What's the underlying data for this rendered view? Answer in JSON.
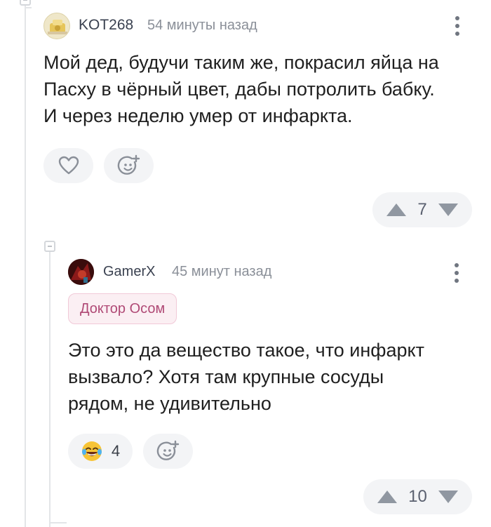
{
  "comments": [
    {
      "username": "KOT268",
      "time": "54 минуты назад",
      "lines": [
        "Мой дед, будучи таким же, покрасил яйца на",
        "Пасху в чёрный цвет, дабы потролить бабку.",
        "И через неделю умер от инфаркта."
      ],
      "rating": "7"
    },
    {
      "username": "GamerX",
      "time": "45 минут назад",
      "badge": "Доктор Осом",
      "lines": [
        "Это это да вещество такое, что инфаркт",
        "вызвало? Хотя там крупные сосуды",
        "рядом, не удивительно"
      ],
      "reaction_count": "4",
      "rating": "10"
    }
  ],
  "icons": {
    "like": "heart-icon",
    "add_reaction": "add-emoji-icon",
    "upvote": "triangle-up-icon",
    "downvote": "triangle-down-icon",
    "reaction": "laughing-tears-emoji-icon",
    "menu": "kebab-menu-icon"
  },
  "colors": {
    "icon_gray": "#8a8f98",
    "pill_bg": "#f3f4f6",
    "badge_text": "#b04a76",
    "badge_bg": "#fbeff3"
  }
}
